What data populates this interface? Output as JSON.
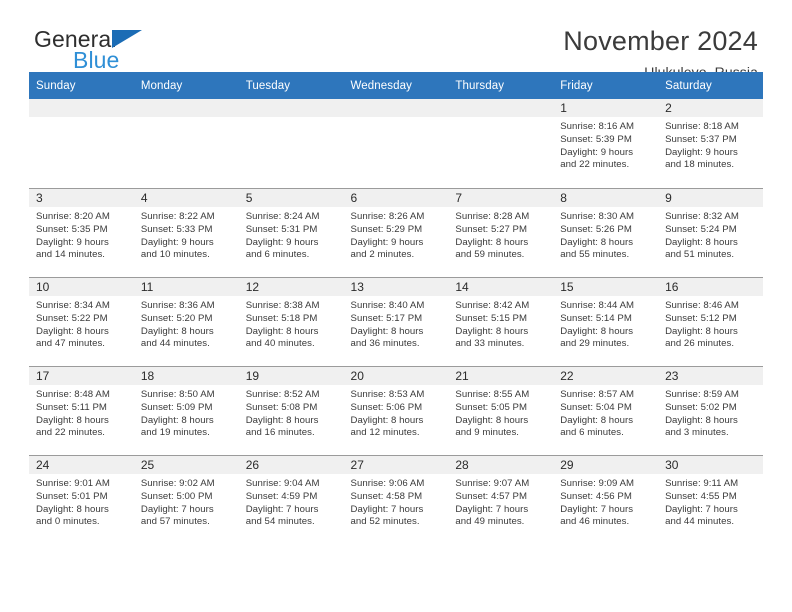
{
  "brand": {
    "name_line1": "General",
    "name_line2": "Blue",
    "triangle_color": "#1b6cb5",
    "blue_text_color": "#2f8fd6"
  },
  "header": {
    "title": "November 2024",
    "location": "Ulukulevo, Russia"
  },
  "theme": {
    "header_row_bg": "#2e76bc",
    "header_row_text": "#ffffff",
    "daynum_band_bg": "#f0f0f0",
    "cell_bg": "#ffffff",
    "grid_line": "#9b9b9b"
  },
  "weekday_headers": [
    "Sunday",
    "Monday",
    "Tuesday",
    "Wednesday",
    "Thursday",
    "Friday",
    "Saturday"
  ],
  "weeks": [
    [
      {
        "day": "",
        "sunrise": "",
        "sunset": "",
        "daylight_line1": "",
        "daylight_line2": ""
      },
      {
        "day": "",
        "sunrise": "",
        "sunset": "",
        "daylight_line1": "",
        "daylight_line2": ""
      },
      {
        "day": "",
        "sunrise": "",
        "sunset": "",
        "daylight_line1": "",
        "daylight_line2": ""
      },
      {
        "day": "",
        "sunrise": "",
        "sunset": "",
        "daylight_line1": "",
        "daylight_line2": ""
      },
      {
        "day": "",
        "sunrise": "",
        "sunset": "",
        "daylight_line1": "",
        "daylight_line2": ""
      },
      {
        "day": "1",
        "sunrise": "Sunrise: 8:16 AM",
        "sunset": "Sunset: 5:39 PM",
        "daylight_line1": "Daylight: 9 hours",
        "daylight_line2": "and 22 minutes."
      },
      {
        "day": "2",
        "sunrise": "Sunrise: 8:18 AM",
        "sunset": "Sunset: 5:37 PM",
        "daylight_line1": "Daylight: 9 hours",
        "daylight_line2": "and 18 minutes."
      }
    ],
    [
      {
        "day": "3",
        "sunrise": "Sunrise: 8:20 AM",
        "sunset": "Sunset: 5:35 PM",
        "daylight_line1": "Daylight: 9 hours",
        "daylight_line2": "and 14 minutes."
      },
      {
        "day": "4",
        "sunrise": "Sunrise: 8:22 AM",
        "sunset": "Sunset: 5:33 PM",
        "daylight_line1": "Daylight: 9 hours",
        "daylight_line2": "and 10 minutes."
      },
      {
        "day": "5",
        "sunrise": "Sunrise: 8:24 AM",
        "sunset": "Sunset: 5:31 PM",
        "daylight_line1": "Daylight: 9 hours",
        "daylight_line2": "and 6 minutes."
      },
      {
        "day": "6",
        "sunrise": "Sunrise: 8:26 AM",
        "sunset": "Sunset: 5:29 PM",
        "daylight_line1": "Daylight: 9 hours",
        "daylight_line2": "and 2 minutes."
      },
      {
        "day": "7",
        "sunrise": "Sunrise: 8:28 AM",
        "sunset": "Sunset: 5:27 PM",
        "daylight_line1": "Daylight: 8 hours",
        "daylight_line2": "and 59 minutes."
      },
      {
        "day": "8",
        "sunrise": "Sunrise: 8:30 AM",
        "sunset": "Sunset: 5:26 PM",
        "daylight_line1": "Daylight: 8 hours",
        "daylight_line2": "and 55 minutes."
      },
      {
        "day": "9",
        "sunrise": "Sunrise: 8:32 AM",
        "sunset": "Sunset: 5:24 PM",
        "daylight_line1": "Daylight: 8 hours",
        "daylight_line2": "and 51 minutes."
      }
    ],
    [
      {
        "day": "10",
        "sunrise": "Sunrise: 8:34 AM",
        "sunset": "Sunset: 5:22 PM",
        "daylight_line1": "Daylight: 8 hours",
        "daylight_line2": "and 47 minutes."
      },
      {
        "day": "11",
        "sunrise": "Sunrise: 8:36 AM",
        "sunset": "Sunset: 5:20 PM",
        "daylight_line1": "Daylight: 8 hours",
        "daylight_line2": "and 44 minutes."
      },
      {
        "day": "12",
        "sunrise": "Sunrise: 8:38 AM",
        "sunset": "Sunset: 5:18 PM",
        "daylight_line1": "Daylight: 8 hours",
        "daylight_line2": "and 40 minutes."
      },
      {
        "day": "13",
        "sunrise": "Sunrise: 8:40 AM",
        "sunset": "Sunset: 5:17 PM",
        "daylight_line1": "Daylight: 8 hours",
        "daylight_line2": "and 36 minutes."
      },
      {
        "day": "14",
        "sunrise": "Sunrise: 8:42 AM",
        "sunset": "Sunset: 5:15 PM",
        "daylight_line1": "Daylight: 8 hours",
        "daylight_line2": "and 33 minutes."
      },
      {
        "day": "15",
        "sunrise": "Sunrise: 8:44 AM",
        "sunset": "Sunset: 5:14 PM",
        "daylight_line1": "Daylight: 8 hours",
        "daylight_line2": "and 29 minutes."
      },
      {
        "day": "16",
        "sunrise": "Sunrise: 8:46 AM",
        "sunset": "Sunset: 5:12 PM",
        "daylight_line1": "Daylight: 8 hours",
        "daylight_line2": "and 26 minutes."
      }
    ],
    [
      {
        "day": "17",
        "sunrise": "Sunrise: 8:48 AM",
        "sunset": "Sunset: 5:11 PM",
        "daylight_line1": "Daylight: 8 hours",
        "daylight_line2": "and 22 minutes."
      },
      {
        "day": "18",
        "sunrise": "Sunrise: 8:50 AM",
        "sunset": "Sunset: 5:09 PM",
        "daylight_line1": "Daylight: 8 hours",
        "daylight_line2": "and 19 minutes."
      },
      {
        "day": "19",
        "sunrise": "Sunrise: 8:52 AM",
        "sunset": "Sunset: 5:08 PM",
        "daylight_line1": "Daylight: 8 hours",
        "daylight_line2": "and 16 minutes."
      },
      {
        "day": "20",
        "sunrise": "Sunrise: 8:53 AM",
        "sunset": "Sunset: 5:06 PM",
        "daylight_line1": "Daylight: 8 hours",
        "daylight_line2": "and 12 minutes."
      },
      {
        "day": "21",
        "sunrise": "Sunrise: 8:55 AM",
        "sunset": "Sunset: 5:05 PM",
        "daylight_line1": "Daylight: 8 hours",
        "daylight_line2": "and 9 minutes."
      },
      {
        "day": "22",
        "sunrise": "Sunrise: 8:57 AM",
        "sunset": "Sunset: 5:04 PM",
        "daylight_line1": "Daylight: 8 hours",
        "daylight_line2": "and 6 minutes."
      },
      {
        "day": "23",
        "sunrise": "Sunrise: 8:59 AM",
        "sunset": "Sunset: 5:02 PM",
        "daylight_line1": "Daylight: 8 hours",
        "daylight_line2": "and 3 minutes."
      }
    ],
    [
      {
        "day": "24",
        "sunrise": "Sunrise: 9:01 AM",
        "sunset": "Sunset: 5:01 PM",
        "daylight_line1": "Daylight: 8 hours",
        "daylight_line2": "and 0 minutes."
      },
      {
        "day": "25",
        "sunrise": "Sunrise: 9:02 AM",
        "sunset": "Sunset: 5:00 PM",
        "daylight_line1": "Daylight: 7 hours",
        "daylight_line2": "and 57 minutes."
      },
      {
        "day": "26",
        "sunrise": "Sunrise: 9:04 AM",
        "sunset": "Sunset: 4:59 PM",
        "daylight_line1": "Daylight: 7 hours",
        "daylight_line2": "and 54 minutes."
      },
      {
        "day": "27",
        "sunrise": "Sunrise: 9:06 AM",
        "sunset": "Sunset: 4:58 PM",
        "daylight_line1": "Daylight: 7 hours",
        "daylight_line2": "and 52 minutes."
      },
      {
        "day": "28",
        "sunrise": "Sunrise: 9:07 AM",
        "sunset": "Sunset: 4:57 PM",
        "daylight_line1": "Daylight: 7 hours",
        "daylight_line2": "and 49 minutes."
      },
      {
        "day": "29",
        "sunrise": "Sunrise: 9:09 AM",
        "sunset": "Sunset: 4:56 PM",
        "daylight_line1": "Daylight: 7 hours",
        "daylight_line2": "and 46 minutes."
      },
      {
        "day": "30",
        "sunrise": "Sunrise: 9:11 AM",
        "sunset": "Sunset: 4:55 PM",
        "daylight_line1": "Daylight: 7 hours",
        "daylight_line2": "and 44 minutes."
      }
    ]
  ]
}
